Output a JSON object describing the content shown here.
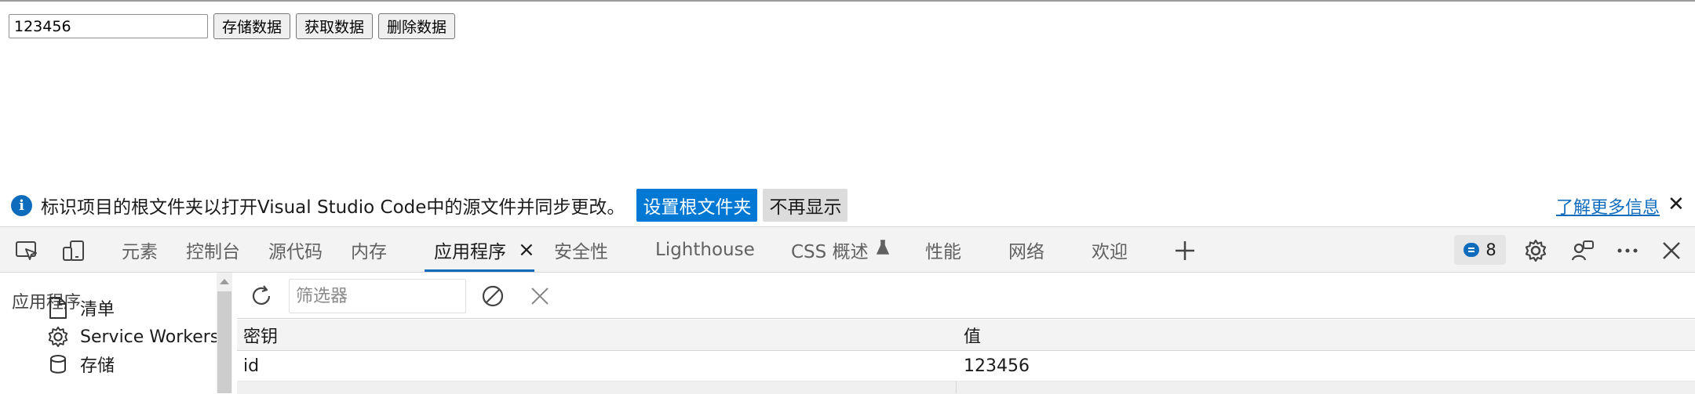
{
  "page": {
    "input_value": "123456",
    "buttons": [
      "存储数据",
      "获取数据",
      "删除数据"
    ]
  },
  "infobar": {
    "icon": "info-icon",
    "text": "标识项目的根文件夹以打开Visual Studio Code中的源文件并同步更改。",
    "primary_button": "设置根文件夹",
    "secondary_button": "不再显示",
    "link": "了解更多信息",
    "close": "✕"
  },
  "devtools": {
    "tabs": {
      "elements": "元素",
      "console": "控制台",
      "sources": "源代码",
      "memory": "内存",
      "application": "应用程序",
      "security": "安全性",
      "lighthouse": "Lighthouse",
      "css_overview": "CSS 概述",
      "performance": "性能",
      "network": "网络",
      "welcome": "欢迎"
    },
    "active_tab": "application",
    "issues_count": "8",
    "accent_color": "#0f6cbd"
  },
  "sidebar": {
    "title": "应用程序",
    "items": [
      {
        "label": "清单",
        "icon": "document-icon"
      },
      {
        "label": "Service Workers",
        "icon": "gear-icon"
      },
      {
        "label": "存储",
        "icon": "database-icon"
      }
    ]
  },
  "storage": {
    "filter_placeholder": "筛选器",
    "columns": [
      "密钥",
      "值"
    ],
    "rows": [
      {
        "key": "id",
        "value": "123456"
      }
    ]
  }
}
